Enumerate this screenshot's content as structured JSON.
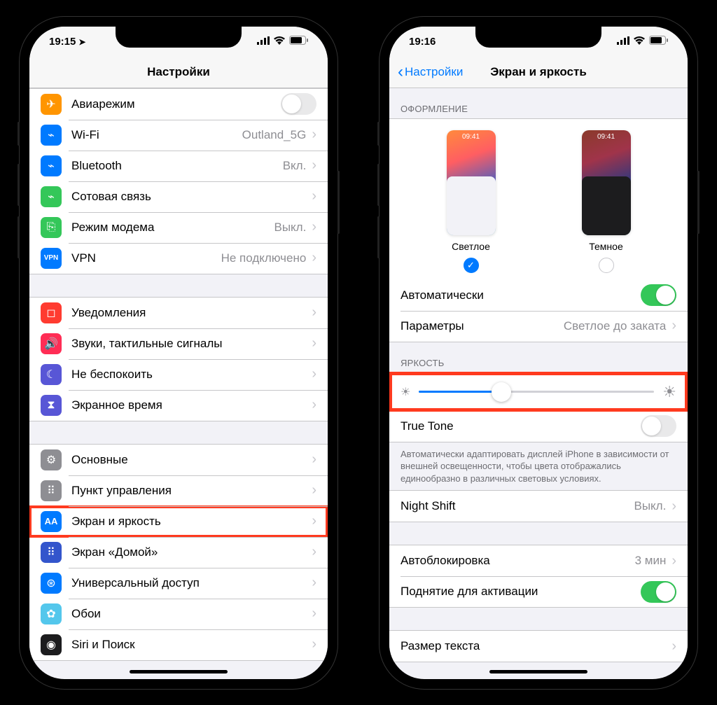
{
  "left_phone": {
    "status": {
      "time": "19:15",
      "has_location_arrow": true
    },
    "nav_title": "Настройки",
    "group1": [
      {
        "icon": "airplane",
        "icon_bg": "#ff9500",
        "label": "Авиарежим",
        "type": "toggle",
        "on": false
      },
      {
        "icon": "wifi",
        "icon_bg": "#007aff",
        "label": "Wi-Fi",
        "value": "Outland_5G"
      },
      {
        "icon": "bluetooth",
        "icon_bg": "#007aff",
        "label": "Bluetooth",
        "value": "Вкл."
      },
      {
        "icon": "antenna",
        "icon_bg": "#34c759",
        "label": "Сотовая связь",
        "value": ""
      },
      {
        "icon": "link",
        "icon_bg": "#34c759",
        "label": "Режим модема",
        "value": "Выкл."
      },
      {
        "icon": "vpn",
        "icon_bg": "#007aff",
        "label": "VPN",
        "value": "Не подключено"
      }
    ],
    "group2": [
      {
        "icon": "bell",
        "icon_bg": "#ff3b30",
        "label": "Уведомления"
      },
      {
        "icon": "speaker",
        "icon_bg": "#ff2d55",
        "label": "Звуки, тактильные сигналы"
      },
      {
        "icon": "moon",
        "icon_bg": "#5856d6",
        "label": "Не беспокоить"
      },
      {
        "icon": "hourglass",
        "icon_bg": "#5856d6",
        "label": "Экранное время"
      }
    ],
    "group3": [
      {
        "icon": "gear",
        "icon_bg": "#8e8e93",
        "label": "Основные"
      },
      {
        "icon": "sliders",
        "icon_bg": "#8e8e93",
        "label": "Пункт управления"
      },
      {
        "icon": "aa",
        "icon_bg": "#007aff",
        "label": "Экран и яркость",
        "highlighted": true
      },
      {
        "icon": "grid",
        "icon_bg": "#3355cc",
        "label": "Экран «Домой»"
      },
      {
        "icon": "accessibility",
        "icon_bg": "#007aff",
        "label": "Универсальный доступ"
      },
      {
        "icon": "flower",
        "icon_bg": "#54c7ec",
        "label": "Обои"
      },
      {
        "icon": "siri",
        "icon_bg": "#1c1c1e",
        "label": "Siri и Поиск"
      }
    ]
  },
  "right_phone": {
    "status": {
      "time": "19:16"
    },
    "nav_back": "Настройки",
    "nav_title": "Экран и яркость",
    "appearance_header": "ОФОРМЛЕНИЕ",
    "appearance_light_label": "Светлое",
    "appearance_dark_label": "Темное",
    "thumb_time": "09:41",
    "appearance_selected": "light",
    "auto_label": "Автоматически",
    "auto_on": true,
    "params_label": "Параметры",
    "params_value": "Светлое до заката",
    "brightness_header": "ЯРКОСТЬ",
    "brightness_percent": 35,
    "truetone_label": "True Tone",
    "truetone_on": false,
    "truetone_hint": "Автоматически адаптировать дисплей iPhone в зависимости от внешней освещенности, чтобы цвета отображались единообразно в различных световых условиях.",
    "nightshift_label": "Night Shift",
    "nightshift_value": "Выкл.",
    "autolock_label": "Автоблокировка",
    "autolock_value": "3 мин",
    "raise_label": "Поднятие для активации",
    "raise_on": true,
    "textsize_label": "Размер текста"
  }
}
